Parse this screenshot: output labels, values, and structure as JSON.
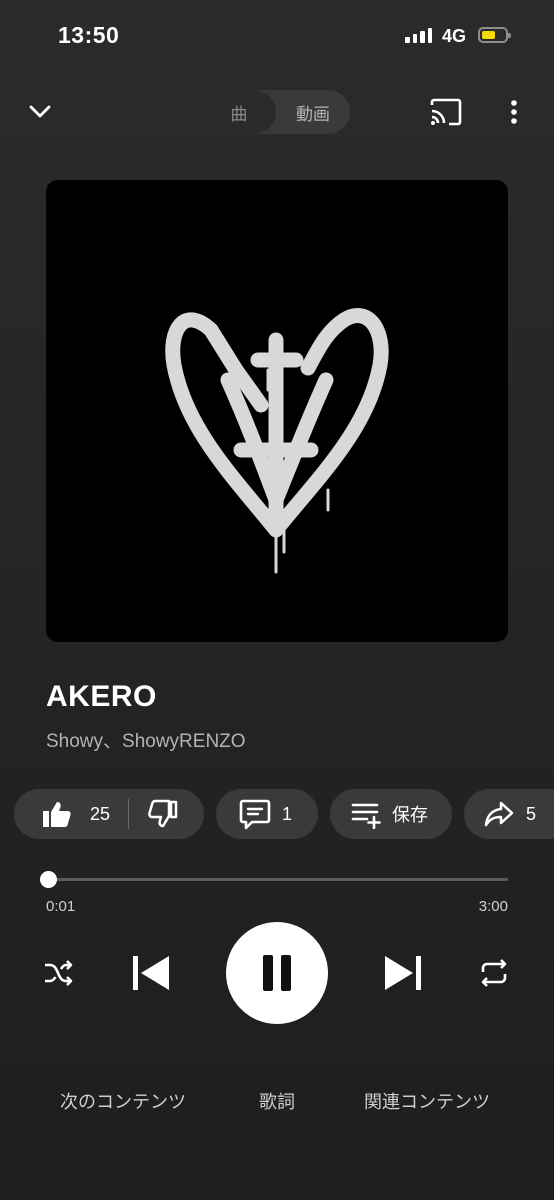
{
  "status": {
    "time": "13:50",
    "network": "4G"
  },
  "header": {
    "seg_song": "曲",
    "seg_video": "動画"
  },
  "song": {
    "title": "AKERO",
    "artist": "Showy、ShowyRENZO"
  },
  "actions": {
    "like_count": "25",
    "comment_count": "1",
    "save_label": "保存",
    "share_count": "5"
  },
  "player": {
    "elapsed": "0:01",
    "duration": "3:00",
    "progress": 0.005
  },
  "tabs": {
    "next": "次のコンテンツ",
    "lyrics": "歌詞",
    "related": "関連コンテンツ"
  },
  "colors": {
    "battery": "#f5d90a",
    "chip": "#3a3a3a",
    "background": "#262626"
  }
}
